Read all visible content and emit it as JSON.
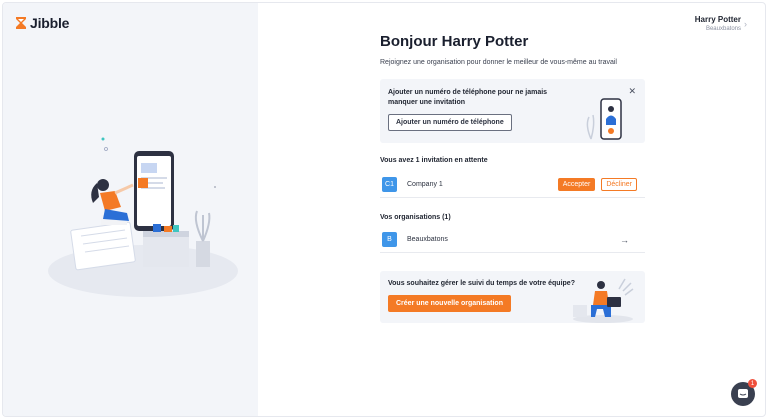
{
  "brand": {
    "name": "Jibble",
    "accent": "#f47a25"
  },
  "user": {
    "name": "Harry Potter",
    "org": "Beauxbatons",
    "menu_icon": "chevron-right-icon"
  },
  "main": {
    "title": "Bonjour Harry Potter",
    "subtitle": "Rejoignez une organisation pour donner le meilleur de vous-même au travail"
  },
  "phone_card": {
    "text": "Ajouter un numéro de téléphone pour ne jamais manquer une invitation",
    "button": "Ajouter un numéro de téléphone",
    "close_icon": "close-icon"
  },
  "invitations": {
    "label": "Vous avez 1 invitation en attente",
    "items": [
      {
        "initials": "C1",
        "name": "Company 1",
        "accept": "Accepter",
        "decline": "Décliner"
      }
    ]
  },
  "organizations": {
    "label": "Vos organisations (1)",
    "items": [
      {
        "initials": "B",
        "name": "Beauxbatons",
        "icon": "arrow-right-icon"
      }
    ]
  },
  "team_card": {
    "text": "Vous souhaitez gérer le suivi du temps de votre équipe?",
    "button": "Créer une nouvelle organisation"
  },
  "chat": {
    "badge": "1",
    "icon": "chat-icon"
  }
}
